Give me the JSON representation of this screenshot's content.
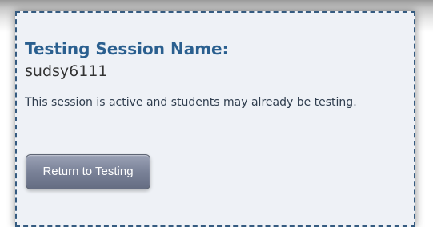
{
  "session": {
    "title": "Testing Session Name:",
    "name": "sudsy6111",
    "status_message": "This session is active and students may already be testing."
  },
  "actions": {
    "return_label": "Return to Testing"
  },
  "colors": {
    "panel_background": "#eef1f6",
    "panel_border": "#355b80",
    "title_text": "#2a5f8f",
    "button_background": "#7a8298",
    "button_text": "#ffffff"
  }
}
